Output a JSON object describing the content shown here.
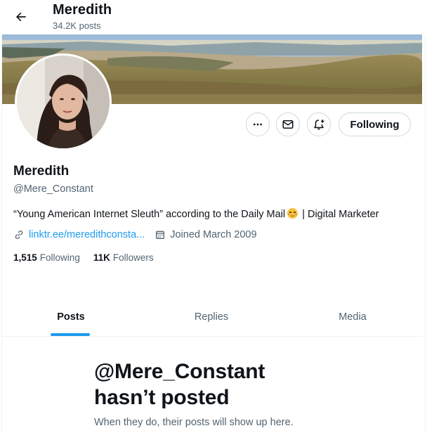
{
  "header": {
    "title": "Meredith",
    "posts_count": "34.2K posts"
  },
  "profile": {
    "name": "Meredith",
    "handle": "@Mere_Constant",
    "bio_before_emoji": "“Young American Internet Sleuth” according to the Daily Mail",
    "bio_after_emoji": "| Digital Marketer",
    "link": "linktr.ee/meredithconsta...",
    "joined": "Joined March 2009",
    "following_count": "1,515",
    "following_label": "Following",
    "followers_count": "11K",
    "followers_label": "Followers"
  },
  "actions": {
    "follow_button_label": "Following",
    "more_icon": "more-icon",
    "message_icon": "envelope-icon",
    "notify_icon": "bell-plus-icon"
  },
  "tabs": [
    {
      "label": "Posts",
      "active": true
    },
    {
      "label": "Replies",
      "active": false
    },
    {
      "label": "Media",
      "active": false
    }
  ],
  "empty_state": {
    "title_line1": "@Mere_Constant",
    "title_line2": "hasn’t posted",
    "subtitle": "When they do, their posts will show up here."
  },
  "colors": {
    "accent": "#1d9bf0",
    "text": "#0f1419",
    "secondary": "#536471",
    "border": "#cfd9de"
  }
}
